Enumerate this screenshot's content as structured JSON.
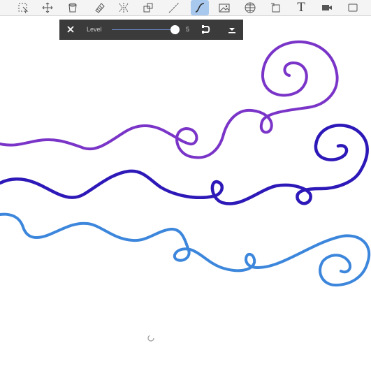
{
  "toolbar": {
    "tools": [
      {
        "name": "selection-tool",
        "icon": "selection-icon"
      },
      {
        "name": "move-tool",
        "icon": "move-icon"
      },
      {
        "name": "bucket-tool",
        "icon": "bucket-icon"
      },
      {
        "name": "pattern-tool",
        "icon": "pattern-icon"
      },
      {
        "name": "symmetry-tool",
        "icon": "symmetry-icon"
      },
      {
        "name": "shape-tool",
        "icon": "shape-icon"
      },
      {
        "name": "ruler-tool",
        "icon": "ruler-icon"
      },
      {
        "name": "curve-tool",
        "icon": "curve-icon",
        "active": true
      },
      {
        "name": "image-tool",
        "icon": "image-icon"
      },
      {
        "name": "perspective-tool",
        "icon": "perspective-icon"
      },
      {
        "name": "transform-tool",
        "icon": "transform-icon"
      },
      {
        "name": "text-tool",
        "icon": "text-icon",
        "text": "T"
      },
      {
        "name": "video-tool",
        "icon": "video-icon"
      },
      {
        "name": "frame-tool",
        "icon": "frame-icon"
      }
    ]
  },
  "level_panel": {
    "label": "Level",
    "value": "5",
    "level_fraction": 0.98,
    "close_icon": "close-icon",
    "undo_icon": "undo-icon",
    "more_icon": "chevron-down-icon"
  },
  "colors": {
    "stroke_purple": "#7a35c8",
    "stroke_indigo": "#2d18b8",
    "stroke_blue": "#3c86dc",
    "accent": "#a9c8ee"
  },
  "status": {
    "spinner_icon": "loading-icon"
  }
}
